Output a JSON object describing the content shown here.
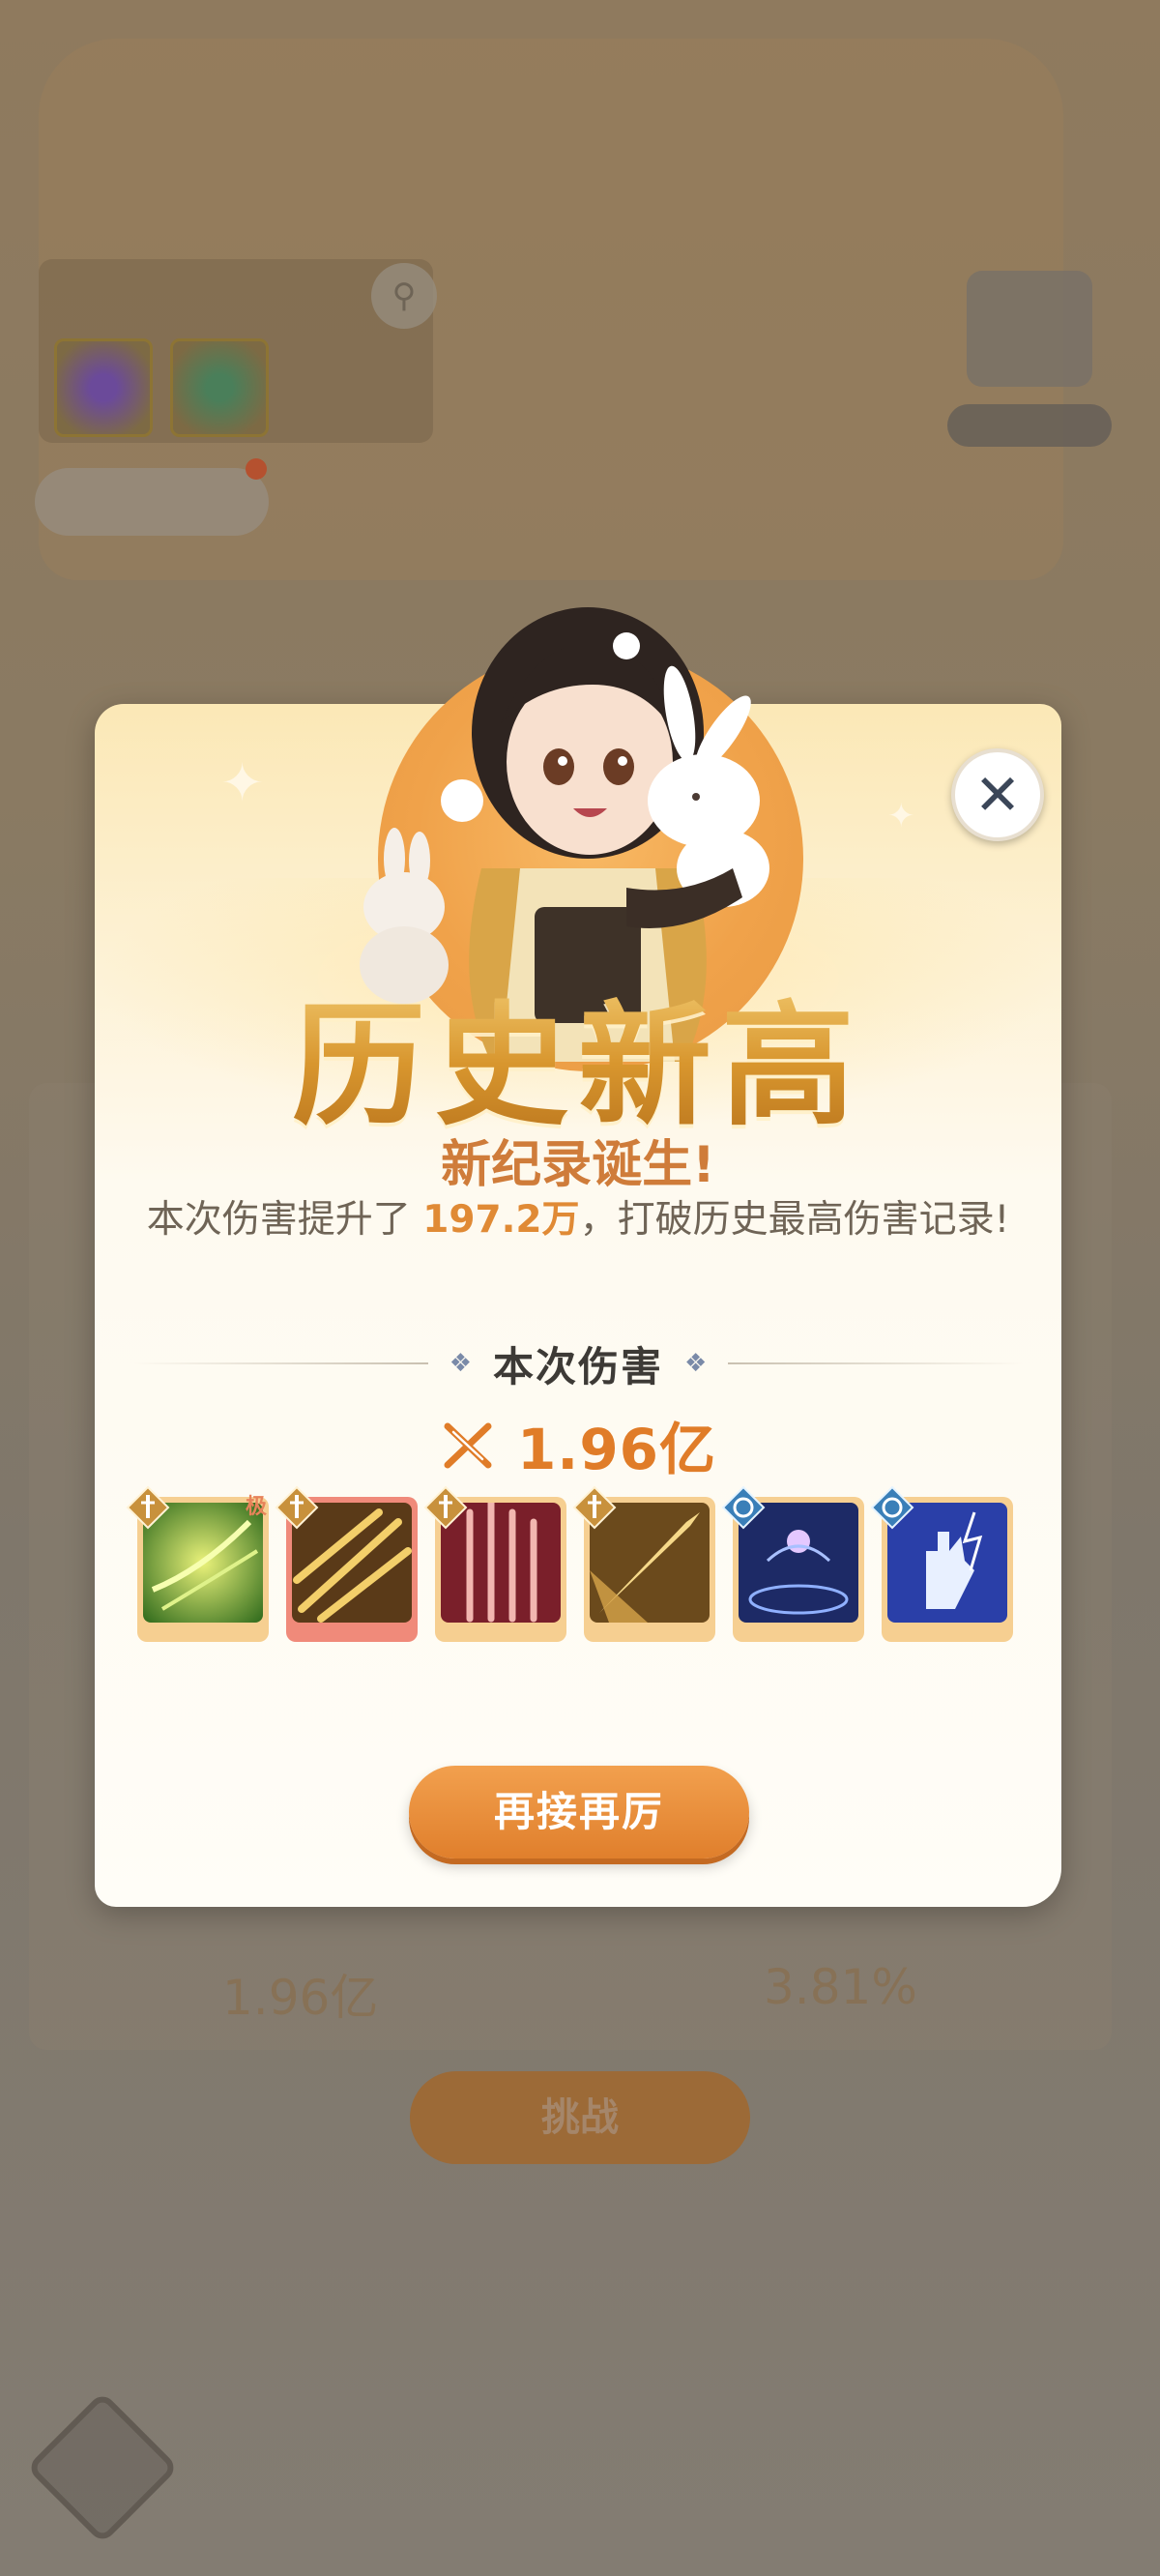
{
  "background": {
    "search_placeholder": "",
    "chip_label": "",
    "right_label": "",
    "stats": [
      "1.96亿",
      "3.81%"
    ],
    "button_label": "挑战"
  },
  "modal": {
    "headline": "历史新高",
    "subtitle": "新纪录诞生!",
    "description": {
      "prefix": "本次伤害提升了 ",
      "highlight": "197.2万",
      "suffix": "，打破历史最高伤害记录!"
    },
    "section_title": "本次伤害",
    "damage_value": "1.96亿",
    "skills": [
      {
        "name": "wind-skill",
        "badge": "sword",
        "tag": "极"
      },
      {
        "name": "golden-blades-skill",
        "badge": "sword",
        "tag": ""
      },
      {
        "name": "crimson-blades-skill",
        "badge": "sword",
        "tag": ""
      },
      {
        "name": "golden-spear-skill",
        "badge": "sword",
        "tag": ""
      },
      {
        "name": "arcane-seal-skill",
        "badge": "magic",
        "tag": ""
      },
      {
        "name": "lightning-hand-skill",
        "badge": "magic",
        "tag": ""
      }
    ],
    "cta_label": "再接再厉",
    "close_icon": "close-icon"
  },
  "colors": {
    "accent_orange": "#e07c28",
    "headline_gold": "#d49a3a",
    "text_dark": "#3d3a36"
  }
}
